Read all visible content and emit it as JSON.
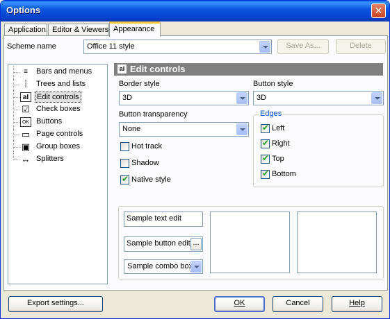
{
  "window": {
    "title": "Options",
    "close_glyph": "✕"
  },
  "tabs": [
    {
      "label": "Application",
      "active": false
    },
    {
      "label": "Editor & Viewers",
      "active": false
    },
    {
      "label": "Appearance",
      "active": true
    }
  ],
  "scheme": {
    "label": "Scheme name",
    "value": "Office 11 style",
    "save_as": "Save As...",
    "delete": "Delete"
  },
  "tree": {
    "items": [
      {
        "label": "Bars and menus",
        "icon": "bars-menus-icon",
        "glyph": "≡"
      },
      {
        "label": "Trees and lists",
        "icon": "tree-list-icon",
        "glyph": "┆"
      },
      {
        "label": "Edit controls",
        "icon": "edit-control-icon",
        "glyph": "aI",
        "selected": true
      },
      {
        "label": "Check boxes",
        "icon": "checkbox-icon",
        "glyph": "☑"
      },
      {
        "label": "Buttons",
        "icon": "button-icon",
        "glyph": "OK"
      },
      {
        "label": "Page controls",
        "icon": "page-control-icon",
        "glyph": "▭"
      },
      {
        "label": "Group boxes",
        "icon": "group-box-icon",
        "glyph": "▣"
      },
      {
        "label": "Splitters",
        "icon": "splitter-icon",
        "glyph": "↔"
      }
    ]
  },
  "section": {
    "title": "Edit controls",
    "icon_glyph": "aI"
  },
  "border_style": {
    "label": "Border style",
    "value": "3D"
  },
  "button_style": {
    "label": "Button style",
    "value": "3D"
  },
  "button_transparency": {
    "label": "Button transparency",
    "value": "None"
  },
  "options": {
    "hot_track": {
      "label": "Hot track",
      "checked": false
    },
    "shadow": {
      "label": "Shadow",
      "checked": false
    },
    "native_style": {
      "label": "Native style",
      "checked": true
    }
  },
  "edges": {
    "label": "Edges",
    "left": {
      "label": "Left",
      "checked": true
    },
    "right": {
      "label": "Right",
      "checked": true
    },
    "top": {
      "label": "Top",
      "checked": true
    },
    "bottom": {
      "label": "Bottom",
      "checked": true
    }
  },
  "samples": {
    "text_edit": "Sample text edit",
    "button_edit": "Sample button edit",
    "button_edit_glyph": "...",
    "combo_box": "Sample combo box"
  },
  "footer": {
    "export": "Export settings...",
    "ok": "OK",
    "cancel": "Cancel",
    "help": "Help"
  },
  "colors": {
    "title_bar": "#0A5FE8",
    "tab_highlight": "#FFC83C",
    "section_header": "#808080",
    "edges_label": "#0046D5"
  }
}
